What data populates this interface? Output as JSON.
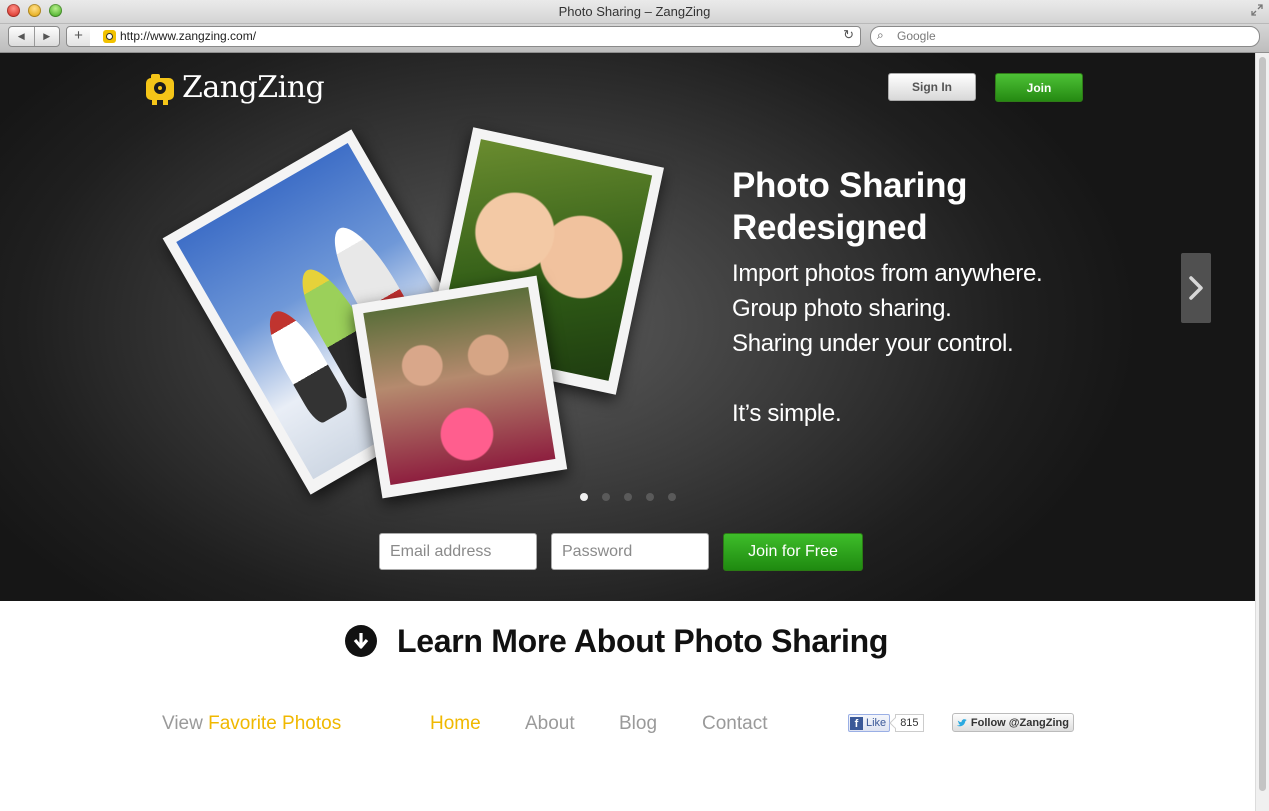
{
  "browser": {
    "title": "Photo Sharing – ZangZing",
    "url": "http://www.zangzing.com/",
    "search_placeholder": "Google",
    "nav_back": "◀",
    "nav_forward": "▶",
    "add_label": "+",
    "reload_label": "↻"
  },
  "header": {
    "logo_text": "ZangZing",
    "signin_label": "Sign In",
    "join_label": "Join"
  },
  "hero": {
    "headline": "Photo Sharing Redesigned",
    "taglines": [
      "Import photos from anywhere.",
      "Group photo sharing.",
      "Sharing under your control.",
      "It’s simple."
    ],
    "slide_count": 5,
    "active_slide": 1
  },
  "signup": {
    "email_placeholder": "Email address",
    "password_placeholder": "Password",
    "button_label": "Join for Free"
  },
  "learn_more": {
    "label": "Learn More About Photo Sharing"
  },
  "footer": {
    "view_prefix": "View",
    "view_accent": "Favorite Photos",
    "nav": [
      "Home",
      "About",
      "Blog",
      "Contact"
    ],
    "facebook_like_label": "Like",
    "facebook_like_count": "815",
    "twitter_follow_label": "Follow @ZangZing"
  },
  "colors": {
    "accent_yellow": "#f0b800",
    "join_green": "#2f9a1a",
    "hero_dark": "#1c1c1c"
  },
  "icons": {
    "logo": "camera-logo-icon",
    "next": "chevron-right-icon",
    "learn_more": "arrow-down-circle-icon",
    "search": "magnifier-icon",
    "facebook": "facebook-icon",
    "twitter": "twitter-bird-icon"
  }
}
